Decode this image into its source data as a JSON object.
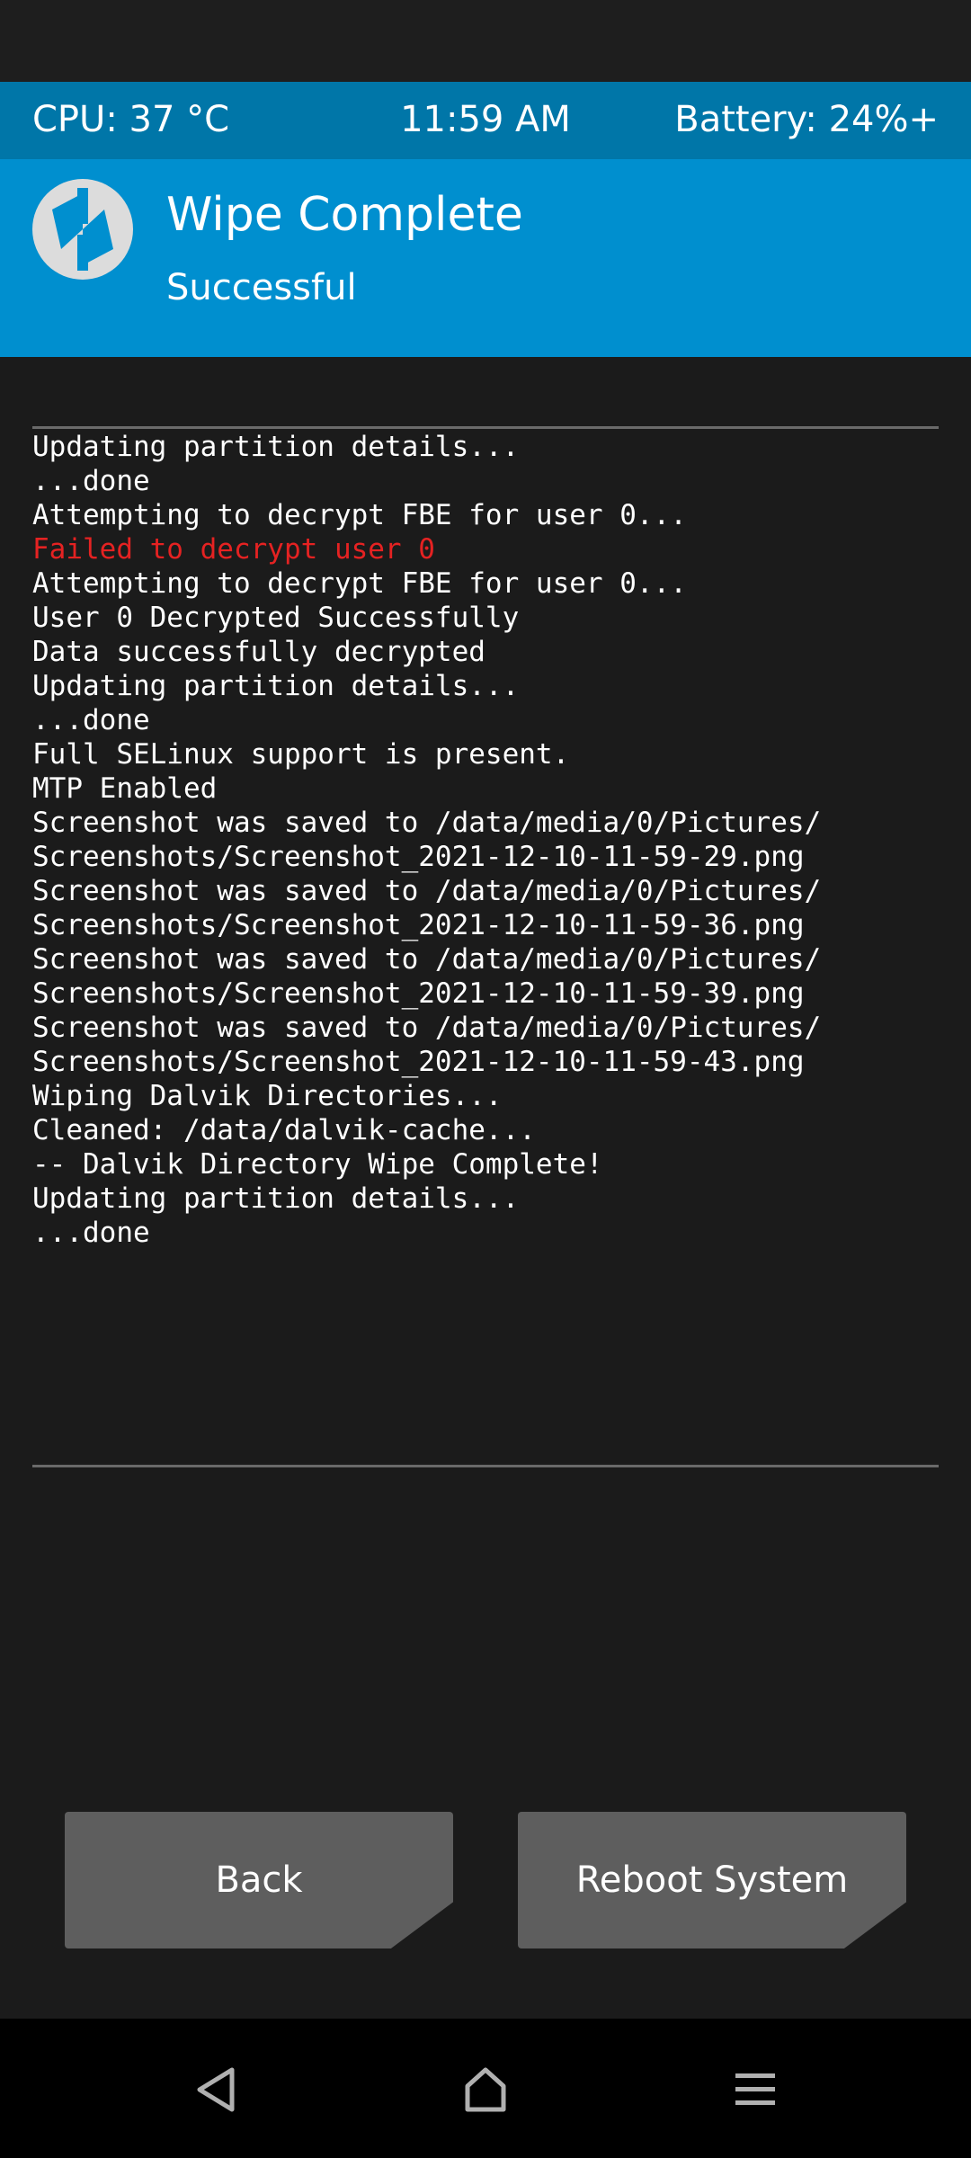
{
  "status": {
    "cpu": "CPU: 37 °C",
    "time": "11:59 AM",
    "battery": "Battery: 24%+"
  },
  "header": {
    "title": "Wipe Complete",
    "subtitle": "Successful",
    "logo_icon": "twrp-logo-icon",
    "background": "#008fcf"
  },
  "console": {
    "lines": [
      {
        "text": "Updating partition details...",
        "type": "normal"
      },
      {
        "text": "...done",
        "type": "normal"
      },
      {
        "text": "Attempting to decrypt FBE for user 0...",
        "type": "normal"
      },
      {
        "text": "Failed to decrypt user 0",
        "type": "error"
      },
      {
        "text": "Attempting to decrypt FBE for user 0...",
        "type": "normal"
      },
      {
        "text": "User 0 Decrypted Successfully",
        "type": "normal"
      },
      {
        "text": "Data successfully decrypted",
        "type": "normal"
      },
      {
        "text": "Updating partition details...",
        "type": "normal"
      },
      {
        "text": "...done",
        "type": "normal"
      },
      {
        "text": "Full SELinux support is present.",
        "type": "normal"
      },
      {
        "text": "MTP Enabled",
        "type": "normal"
      },
      {
        "text": "Screenshot was saved to /data/media/0/Pictures/",
        "type": "normal"
      },
      {
        "text": "Screenshots/Screenshot_2021-12-10-11-59-29.png",
        "type": "normal"
      },
      {
        "text": "Screenshot was saved to /data/media/0/Pictures/",
        "type": "normal"
      },
      {
        "text": "Screenshots/Screenshot_2021-12-10-11-59-36.png",
        "type": "normal"
      },
      {
        "text": "Screenshot was saved to /data/media/0/Pictures/",
        "type": "normal"
      },
      {
        "text": "Screenshots/Screenshot_2021-12-10-11-59-39.png",
        "type": "normal"
      },
      {
        "text": "Screenshot was saved to /data/media/0/Pictures/",
        "type": "normal"
      },
      {
        "text": "Screenshots/Screenshot_2021-12-10-11-59-43.png",
        "type": "normal"
      },
      {
        "text": "Wiping Dalvik Directories...",
        "type": "normal"
      },
      {
        "text": "Cleaned: /data/dalvik-cache...",
        "type": "normal"
      },
      {
        "text": "-- Dalvik Directory Wipe Complete!",
        "type": "normal"
      },
      {
        "text": "Updating partition details...",
        "type": "normal"
      },
      {
        "text": "...done",
        "type": "normal"
      }
    ]
  },
  "buttons": {
    "back": "Back",
    "reboot": "Reboot System"
  },
  "navbar": {
    "back_icon": "nav-back-icon",
    "home_icon": "nav-home-icon",
    "menu_icon": "nav-menu-icon"
  },
  "colors": {
    "status_bar": "#0076a8",
    "header": "#008fcf",
    "error_text": "#e52222",
    "button": "#5e5e5e",
    "background": "#1b1b1b"
  }
}
